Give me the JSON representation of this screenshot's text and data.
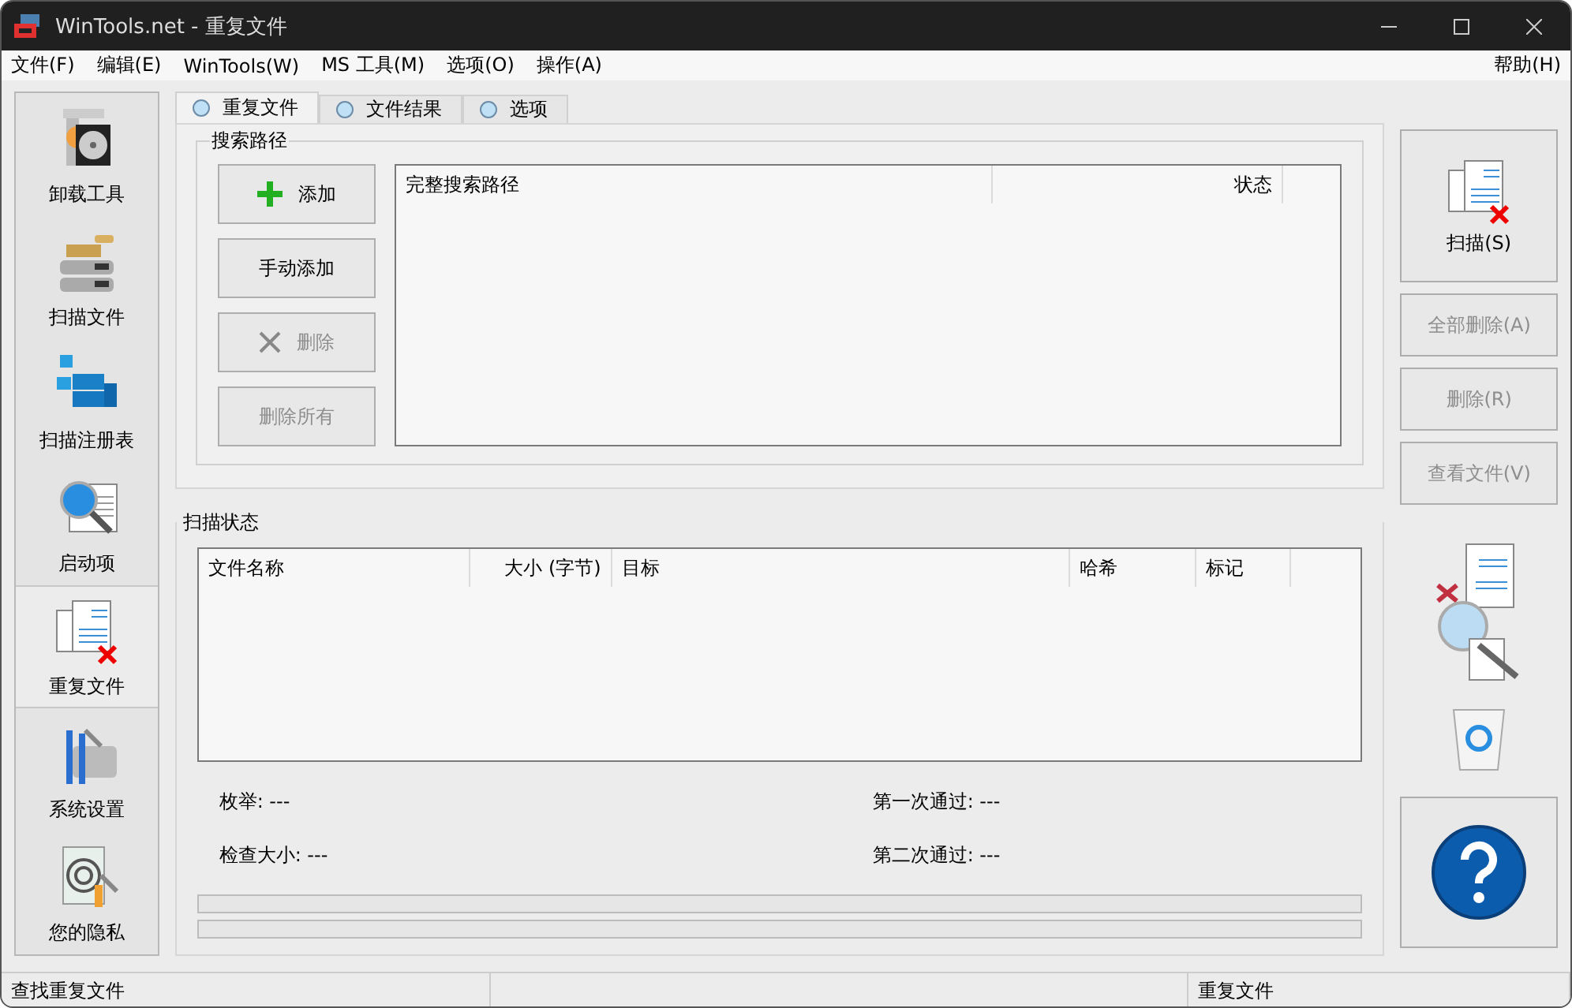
{
  "window": {
    "title": "WinTools.net - 重复文件"
  },
  "menu": {
    "left": [
      "文件(F)",
      "编辑(E)",
      "WinTools(W)",
      "MS 工具(M)",
      "选项(O)",
      "操作(A)"
    ],
    "right": [
      "帮助(H)"
    ]
  },
  "sidebar": [
    {
      "label": "卸载工具",
      "kind": "uninstall",
      "selected": false
    },
    {
      "label": "扫描文件",
      "kind": "scanfiles",
      "selected": false
    },
    {
      "label": "扫描注册表",
      "kind": "registry",
      "selected": false
    },
    {
      "label": "启动项",
      "kind": "startup",
      "selected": false
    },
    {
      "label": "重复文件",
      "kind": "duplicate",
      "selected": true
    },
    {
      "label": "系统设置",
      "kind": "tweak",
      "selected": false
    },
    {
      "label": "您的隐私",
      "kind": "privacy",
      "selected": false
    }
  ],
  "tabs": [
    {
      "label": "重复文件",
      "selected": true
    },
    {
      "label": "文件结果",
      "selected": false
    },
    {
      "label": "选项",
      "selected": false
    }
  ],
  "search_path": {
    "title": "搜索路径",
    "buttons": [
      {
        "label": "添加",
        "kind": "add",
        "disabled": false
      },
      {
        "label": "手动添加",
        "kind": "plain",
        "disabled": false
      },
      {
        "label": "删除",
        "kind": "remove",
        "disabled": true
      },
      {
        "label": "删除所有",
        "kind": "plain",
        "disabled": true
      }
    ],
    "columns": [
      "完整搜索路径",
      "状态"
    ]
  },
  "scan_status": {
    "title": "扫描状态",
    "columns": [
      "文件名称",
      "大小 (字节)",
      "目标",
      "哈希",
      "标记"
    ],
    "stats": [
      {
        "label": "枚举: ---"
      },
      {
        "label": "第一次通过: ---"
      },
      {
        "label": "检查大小: ---"
      },
      {
        "label": "第二次通过: ---"
      }
    ],
    "progress": [
      {
        "level": 0
      },
      {
        "level": 0
      }
    ]
  },
  "actions": [
    {
      "label": "扫描(S)",
      "kind": "scan",
      "disabled": false
    },
    {
      "label": "全部删除(A)",
      "kind": "plain",
      "disabled": true
    },
    {
      "label": "删除(R)",
      "kind": "plain",
      "disabled": true
    },
    {
      "label": "查看文件(V)",
      "kind": "plain",
      "disabled": true
    }
  ],
  "status_bar": [
    "查找重复文件",
    "重复文件"
  ]
}
